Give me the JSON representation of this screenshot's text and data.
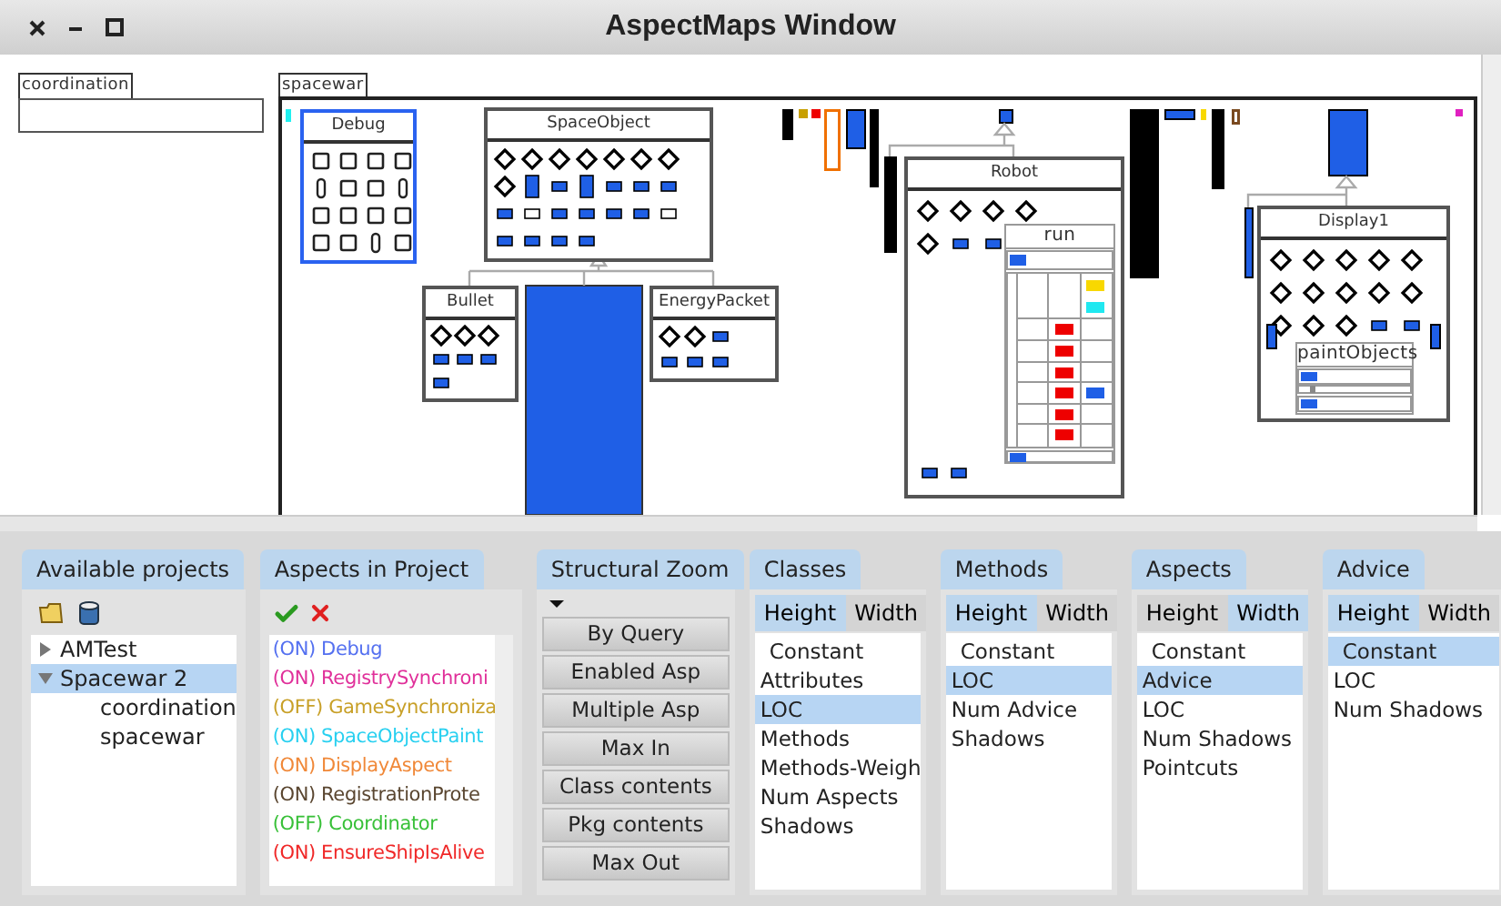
{
  "window": {
    "title": "AspectMaps Window"
  },
  "canvas": {
    "packages": [
      {
        "name": "coordination"
      },
      {
        "name": "spacewar"
      }
    ],
    "classes": [
      {
        "name": "Debug",
        "selected": true
      },
      {
        "name": "SpaceObject",
        "selected": false
      },
      {
        "name": "Bullet",
        "selected": false
      },
      {
        "name": "EnergyPacket",
        "selected": false
      },
      {
        "name": "Robot",
        "selected": false
      },
      {
        "name": "Display1",
        "selected": false
      }
    ],
    "methods": [
      {
        "name": "run"
      },
      {
        "name": "paintObjects"
      }
    ]
  },
  "projects": {
    "tab": "Available projects",
    "items": [
      {
        "label": "AMTest",
        "expanded": false,
        "selected": false
      },
      {
        "label": "Spacewar 2",
        "expanded": true,
        "selected": true,
        "children": [
          {
            "label": "coordination"
          },
          {
            "label": "spacewar"
          }
        ]
      }
    ]
  },
  "aspects_in_project": {
    "tab": "Aspects in Project",
    "items": [
      {
        "label": "(ON) Debug",
        "color": "#5470f0"
      },
      {
        "label": "(ON) RegistrySynchroni",
        "color": "#e0309a"
      },
      {
        "label": "(OFF) GameSynchroniza",
        "color": "#c8a028"
      },
      {
        "label": "(ON) SpaceObjectPaint",
        "color": "#28d0f0"
      },
      {
        "label": "(ON) DisplayAspect",
        "color": "#f08838"
      },
      {
        "label": "(ON) RegistrationProte",
        "color": "#5a4630"
      },
      {
        "label": "(OFF) Coordinator",
        "color": "#38c038"
      },
      {
        "label": "(ON) EnsureShipIsAlive",
        "color": "#f02828"
      }
    ]
  },
  "structural_zoom": {
    "tab": "Structural Zoom",
    "buttons": [
      "By Query",
      "Enabled Asp",
      "Multiple Asp",
      "Max In",
      "Class contents",
      "Pkg contents",
      "Max Out"
    ]
  },
  "metrics": [
    {
      "tab": "Classes",
      "subtabs": [
        {
          "label": "Height",
          "selected": true
        },
        {
          "label": "Width",
          "selected": false
        }
      ],
      "items": [
        {
          "label": "Constant",
          "selected": false
        },
        {
          "label": "Attributes",
          "selected": false
        },
        {
          "label": "LOC",
          "selected": true
        },
        {
          "label": "Methods",
          "selected": false
        },
        {
          "label": "Methods-Weigh",
          "selected": false
        },
        {
          "label": "Num Aspects",
          "selected": false
        },
        {
          "label": "Shadows",
          "selected": false
        }
      ]
    },
    {
      "tab": "Methods",
      "subtabs": [
        {
          "label": "Height",
          "selected": true
        },
        {
          "label": "Width",
          "selected": false
        }
      ],
      "items": [
        {
          "label": "Constant",
          "selected": false
        },
        {
          "label": "LOC",
          "selected": true
        },
        {
          "label": "Num Advice",
          "selected": false
        },
        {
          "label": "Shadows",
          "selected": false
        }
      ]
    },
    {
      "tab": "Aspects",
      "subtabs": [
        {
          "label": "Height",
          "selected": false
        },
        {
          "label": "Width",
          "selected": true
        }
      ],
      "items": [
        {
          "label": "Constant",
          "selected": false
        },
        {
          "label": "Advice",
          "selected": true
        },
        {
          "label": "LOC",
          "selected": false
        },
        {
          "label": "Num Shadows",
          "selected": false
        },
        {
          "label": "Pointcuts",
          "selected": false
        }
      ]
    },
    {
      "tab": "Advice",
      "subtabs": [
        {
          "label": "Height",
          "selected": true
        },
        {
          "label": "Width",
          "selected": false
        }
      ],
      "items": [
        {
          "label": "Constant",
          "selected": true
        },
        {
          "label": "LOC",
          "selected": false
        },
        {
          "label": "Num Shadows",
          "selected": false
        }
      ]
    }
  ]
}
